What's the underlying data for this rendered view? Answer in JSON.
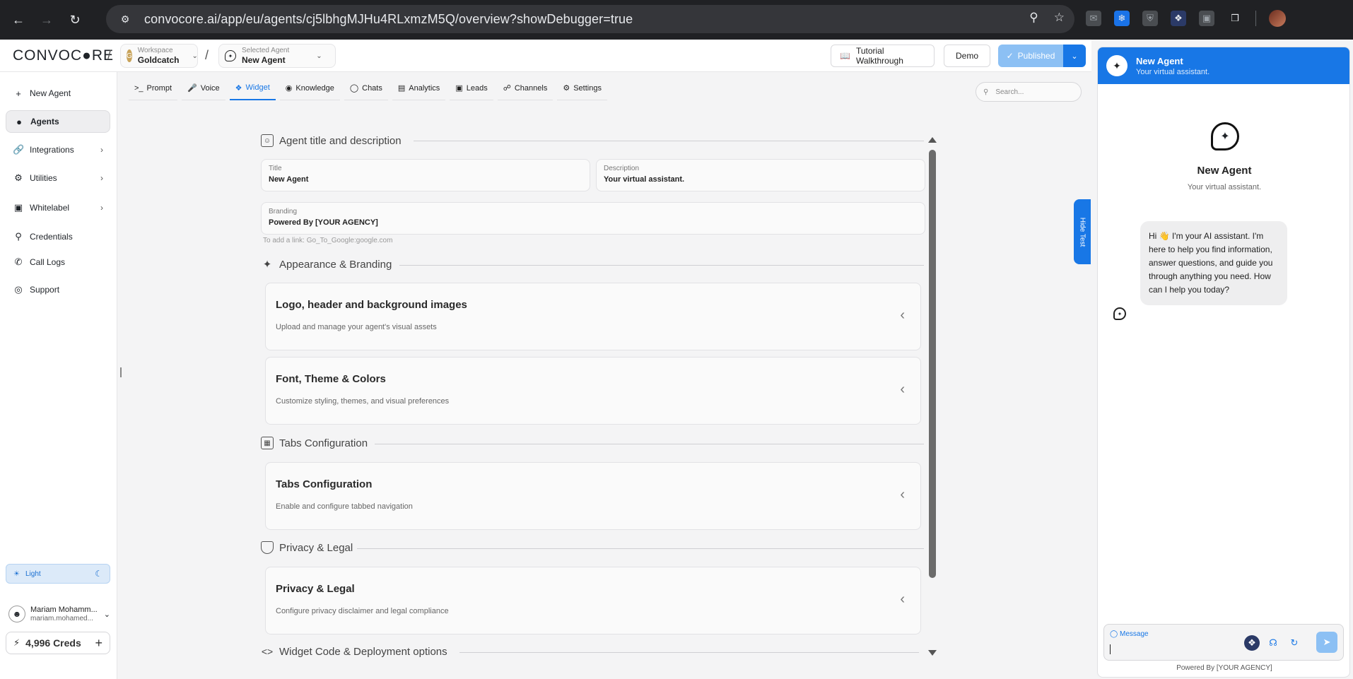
{
  "browser": {
    "url": "convocore.ai/app/eu/agents/cj5lbhgMJHu4RLxmzM5Q/overview?showDebugger=true"
  },
  "app": {
    "logo": "CONVOC●RE",
    "workspace": {
      "label": "Workspace",
      "value": "Goldcatch"
    },
    "agent": {
      "label": "Selected Agent",
      "value": "New Agent"
    },
    "tutorial_label": "Tutorial Walkthrough",
    "demo_label": "Demo",
    "published_label": "Published"
  },
  "sidebar": {
    "items": [
      {
        "label": "New Agent",
        "icon": "plus-icon"
      },
      {
        "label": "Agents",
        "icon": "agents-icon"
      },
      {
        "label": "Integrations",
        "icon": "link-icon"
      },
      {
        "label": "Utilities",
        "icon": "gear-icon"
      },
      {
        "label": "Whitelabel",
        "icon": "badge-icon"
      },
      {
        "label": "Credentials",
        "icon": "key-icon"
      },
      {
        "label": "Call Logs",
        "icon": "phone-icon"
      },
      {
        "label": "Support",
        "icon": "lifebuoy-icon"
      }
    ],
    "theme_label": "Light",
    "user": {
      "name": "Mariam Mohamm...",
      "email": "mariam.mohamed..."
    },
    "creds": "4,996 Creds"
  },
  "tabs": [
    {
      "label": "Prompt"
    },
    {
      "label": "Voice"
    },
    {
      "label": "Widget"
    },
    {
      "label": "Knowledge"
    },
    {
      "label": "Chats"
    },
    {
      "label": "Analytics"
    },
    {
      "label": "Leads"
    },
    {
      "label": "Channels"
    },
    {
      "label": "Settings"
    }
  ],
  "search_placeholder": "Search...",
  "sections": {
    "agent": "Agent title and description",
    "appearance": "Appearance & Branding",
    "tabs": "Tabs Configuration",
    "privacy": "Privacy & Legal",
    "widget": "Widget Code & Deployment options"
  },
  "fields": {
    "title": {
      "label": "Title",
      "value": "New Agent"
    },
    "description": {
      "label": "Description",
      "value": "Your virtual assistant."
    },
    "branding": {
      "label": "Branding",
      "value": "Powered By [YOUR AGENCY]"
    },
    "hint": "To add a link: Go_To_Google:google.com"
  },
  "cards": [
    {
      "title": "Logo, header and background images",
      "desc": "Upload and manage your agent's visual assets"
    },
    {
      "title": "Font, Theme & Colors",
      "desc": "Customize styling, themes, and visual preferences"
    },
    {
      "title": "Tabs Configuration",
      "desc": "Enable and configure tabbed navigation"
    },
    {
      "title": "Privacy & Legal",
      "desc": "Configure privacy disclaimer and legal compliance"
    }
  ],
  "hide_test": "Hide Test",
  "chat": {
    "header_name": "New Agent",
    "header_sub": "Your virtual assistant.",
    "title": "New Agent",
    "sub": "Your virtual assistant.",
    "message": "Hi 👋 I'm your AI assistant. I'm here to help you find information, answer questions, and guide you through anything you need. How can I help you today?",
    "input_label": "Message",
    "powered": "Powered By [YOUR AGENCY]"
  },
  "colors": {
    "accent": "#1877e6",
    "accent_light": "#8cc0f4"
  }
}
